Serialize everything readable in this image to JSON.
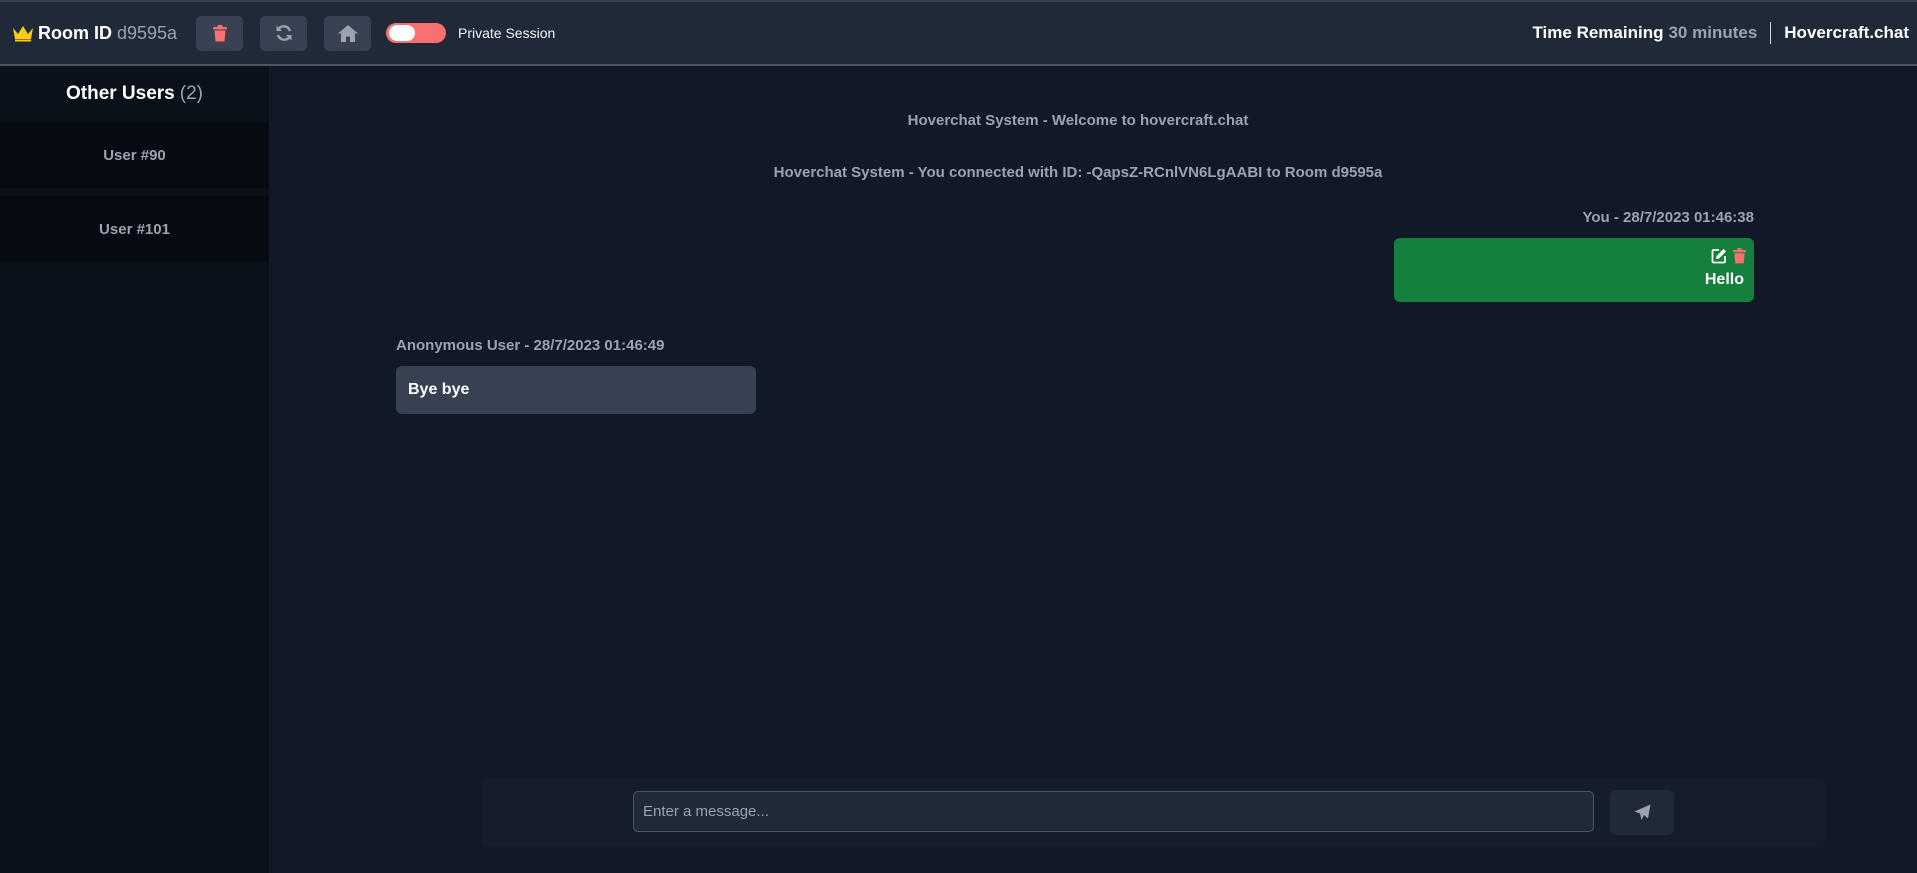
{
  "header": {
    "room_label": "Room ID",
    "room_id": "d9595a",
    "private_session_label": "Private Session",
    "private_session_on": false,
    "time_remaining_label": "Time Remaining",
    "time_remaining_value": "30 minutes",
    "brand": "Hovercraft.chat",
    "icons": {
      "crown": "crown-icon",
      "delete_room": "trash-icon",
      "refresh": "refresh-icon",
      "home": "home-icon"
    }
  },
  "sidebar": {
    "title": "Other Users",
    "count": "(2)",
    "users": [
      {
        "label": "User #90"
      },
      {
        "label": "User #101"
      }
    ]
  },
  "chat": {
    "system_messages": [
      "Hoverchat System - Welcome to hovercraft.chat",
      "Hoverchat System - You connected with ID: -QapsZ-RCnlVN6LgAABI to Room d9595a"
    ],
    "own_message": {
      "meta": "You - 28/7/2023 01:46:38",
      "text": "Hello",
      "icons": [
        "edit-icon",
        "trash-icon"
      ]
    },
    "other_message": {
      "meta": "Anonymous User - 28/7/2023 01:46:49",
      "text": "Bye bye"
    }
  },
  "composer": {
    "placeholder": "Enter a message...",
    "value": "",
    "send_icon": "send-icon"
  },
  "colors": {
    "background": "#111827",
    "topbar": "#1f2937",
    "sidebar": "#0b111b",
    "own_bubble": "#15803d",
    "other_bubble": "#374151",
    "danger": "#f87171",
    "crown": "#facc15"
  }
}
